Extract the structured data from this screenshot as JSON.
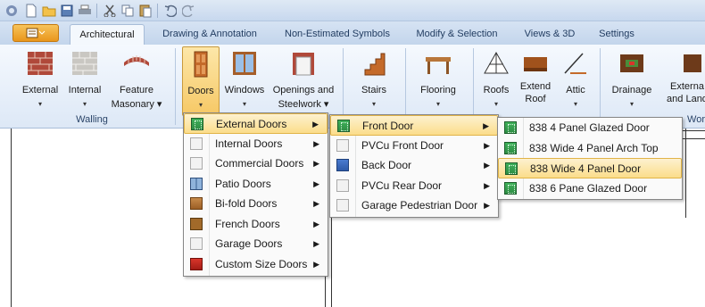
{
  "quick_access": {
    "icons": [
      "app-logo-icon",
      "new-icon",
      "open-icon",
      "save-icon",
      "print-icon",
      "cut-icon",
      "copy-icon",
      "paste-icon",
      "undo-icon",
      "redo-icon"
    ]
  },
  "tabs": [
    {
      "label": "Architectural",
      "active": true
    },
    {
      "label": "Drawing & Annotation"
    },
    {
      "label": "Non-Estimated Symbols"
    },
    {
      "label": "Modify & Selection"
    },
    {
      "label": "Views & 3D"
    },
    {
      "label": "Settings"
    }
  ],
  "ribbon": {
    "walling_group_label": "Walling",
    "external": "External",
    "internal": "Internal",
    "feature_masonary_1": "Feature",
    "feature_masonary_2": "Masonary",
    "doors": "Doors",
    "windows": "Windows",
    "openings_1": "Openings and",
    "openings_2": "Steelwork",
    "stairs": "Stairs",
    "flooring": "Flooring",
    "roofs": "Roofs",
    "extend_roof_1": "Extend",
    "extend_roof_2": "Roof",
    "attic": "Attic",
    "drainage": "Drainage",
    "external_land_1": "Externa",
    "external_land_2": "and Land",
    "wor_group_label": "Wor"
  },
  "menu1": [
    {
      "label": "External Doors",
      "icon": "green-door-icon",
      "highlighted": true
    },
    {
      "label": "Internal Doors",
      "icon": "internal-door-icon"
    },
    {
      "label": "Commercial Doors",
      "icon": "commercial-door-icon"
    },
    {
      "label": "Patio Doors",
      "icon": "patio-door-icon"
    },
    {
      "label": "Bi-fold Doors",
      "icon": "bifold-door-icon"
    },
    {
      "label": "French Doors",
      "icon": "french-door-icon"
    },
    {
      "label": "Garage Doors",
      "icon": "garage-door-icon"
    },
    {
      "label": "Custom Size Doors",
      "icon": "custom-door-icon"
    }
  ],
  "menu2": [
    {
      "label": "Front Door",
      "highlighted": true
    },
    {
      "label": "PVCu Front Door"
    },
    {
      "label": "Back Door"
    },
    {
      "label": "PVCu Rear Door"
    },
    {
      "label": "Garage Pedestrian Door"
    }
  ],
  "menu3": [
    {
      "label": "838 4 Panel Glazed Door"
    },
    {
      "label": "838 Wide 4 Panel Arch Top"
    },
    {
      "label": "838 Wide 4 Panel Door",
      "highlighted": true
    },
    {
      "label": "838 6 Pane Glazed Door"
    }
  ],
  "colors": {
    "file_button": "#e9961c",
    "highlight": "#fbdd8a",
    "ribbon_bg": "#dde8f6"
  }
}
